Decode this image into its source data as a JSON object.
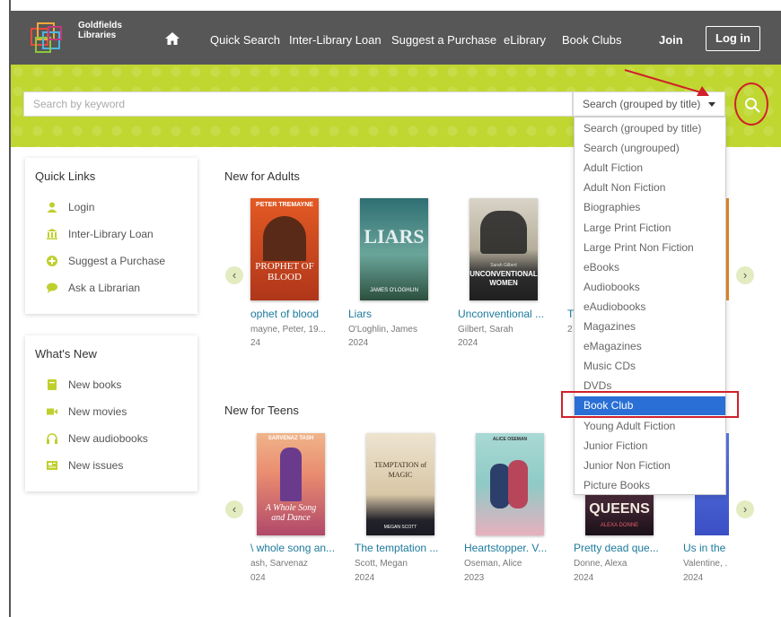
{
  "header": {
    "logo_text_1": "Goldfields",
    "logo_text_2": "Libraries",
    "nav": [
      "Quick Search",
      "Inter-Library Loan",
      "Suggest a Purchase",
      "eLibrary",
      "Book Clubs"
    ],
    "join": "Join",
    "login": "Log in"
  },
  "search": {
    "placeholder": "Search by keyword",
    "selected": "Search (grouped by title)"
  },
  "dropdown": {
    "options": [
      "Search (grouped by title)",
      "Search (ungrouped)",
      "Adult Fiction",
      "Adult Non Fiction",
      "Biographies",
      "Large Print Fiction",
      "Large Print Non Fiction",
      "eBooks",
      "Audiobooks",
      "eAudiobooks",
      "Magazines",
      "eMagazines",
      "Music CDs",
      "DVDs",
      "Book Club",
      "Young Adult Fiction",
      "Junior Fiction",
      "Junior Non Fiction",
      "Picture Books"
    ],
    "highlighted": "Book Club"
  },
  "quick_links": {
    "title": "Quick Links",
    "items": [
      "Login",
      "Inter-Library Loan",
      "Suggest a Purchase",
      "Ask a Librarian"
    ]
  },
  "whats_new": {
    "title": "What's New",
    "items": [
      "New books",
      "New movies",
      "New audiobooks",
      "New issues"
    ]
  },
  "adults": {
    "title": "New for Adults",
    "books": [
      {
        "title": "ophet of blood",
        "author": "mayne, Peter, 19...",
        "year": "24",
        "cover_top": "PETER TREMAYNE",
        "cover_main": "PROPHET OF BLOOD"
      },
      {
        "title": "Liars",
        "author": "O'Loghlin, James",
        "year": "2024",
        "cover_main": "LIARS",
        "cover_bottom": "JAMES O'LOGHLIN"
      },
      {
        "title": "Unconventional ...",
        "author": "Gilbert, Sarah",
        "year": "2024",
        "cover_main": "UNCONVENTIONAL WOMEN",
        "cover_top": "Sarah Gilbert"
      },
      {
        "title": "T",
        "author": "",
        "year": "2"
      }
    ]
  },
  "teens": {
    "title": "New for Teens",
    "books": [
      {
        "title": "\\ whole song an...",
        "author": "ash, Sarvenaz",
        "year": "024",
        "cover_top": "SARVENAZ TASH",
        "cover_main": "A Whole Song and Dance"
      },
      {
        "title": "The temptation ...",
        "author": "Scott, Megan",
        "year": "2024",
        "cover_main": "TEMPTATION of MAGIC",
        "cover_bottom": "MEGAN SCOTT"
      },
      {
        "title": "Heartstopper. V...",
        "author": "Oseman, Alice",
        "year": "2023",
        "cover_top": "ALICE OSEMAN"
      },
      {
        "title": "Pretty dead que...",
        "author": "Donne, Alexa",
        "year": "2024",
        "cover_main": "QUEENS",
        "cover_bottom": "ALEXA DONNE"
      },
      {
        "title": "Us in the",
        "author": "Valentine, .",
        "year": "2024"
      }
    ]
  },
  "carousel": {
    "prev": "‹",
    "next": "›"
  },
  "colors": {
    "header": "#575757",
    "band": "#bfd730",
    "link": "#1c7a9c",
    "annotation": "#d0202a",
    "selected": "#2a6fd6"
  }
}
